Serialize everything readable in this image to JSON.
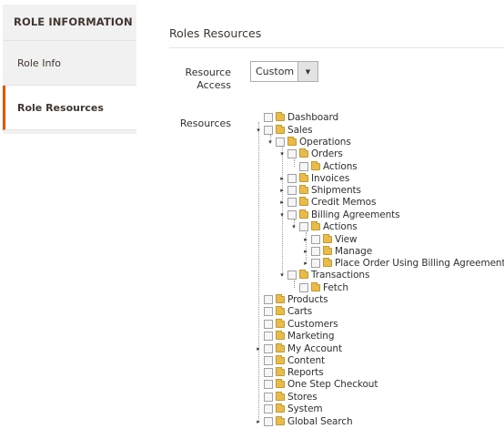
{
  "sidebar": {
    "title": "ROLE INFORMATION",
    "items": [
      {
        "label": "Role Info",
        "active": false
      },
      {
        "label": "Role Resources",
        "active": true
      }
    ]
  },
  "main": {
    "title": "Roles Resources",
    "resource_access": {
      "label": "Resource Access",
      "value": "Custom"
    },
    "resources_label": "Resources"
  },
  "tree": [
    {
      "label": "Dashboard"
    },
    {
      "label": "Sales"
    },
    {
      "label": "Operations"
    },
    {
      "label": "Orders"
    },
    {
      "label": "Actions"
    },
    {
      "label": "Invoices"
    },
    {
      "label": "Shipments"
    },
    {
      "label": "Credit Memos"
    },
    {
      "label": "Billing Agreements"
    },
    {
      "label": "Actions"
    },
    {
      "label": "View"
    },
    {
      "label": "Manage"
    },
    {
      "label": "Place Order Using Billing Agreements"
    },
    {
      "label": "Transactions"
    },
    {
      "label": "Fetch"
    },
    {
      "label": "Products"
    },
    {
      "label": "Carts"
    },
    {
      "label": "Customers"
    },
    {
      "label": "Marketing"
    },
    {
      "label": "My Account"
    },
    {
      "label": "Content"
    },
    {
      "label": "Reports"
    },
    {
      "label": "One Step Checkout"
    },
    {
      "label": "Stores"
    },
    {
      "label": "System"
    },
    {
      "label": "Global Search"
    }
  ],
  "icons": {
    "dropdown": "chevron-down-icon",
    "folder": "folder-icon",
    "checkbox": "checkbox-icon",
    "toggle": "tree-toggle-icon"
  }
}
